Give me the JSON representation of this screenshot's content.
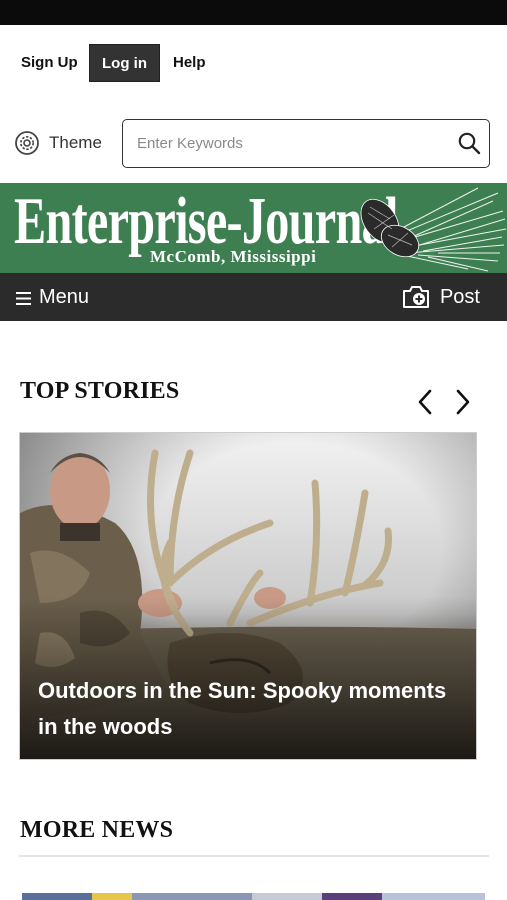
{
  "account": {
    "signup_label": "Sign Up",
    "login_label": "Log in",
    "help_label": "Help"
  },
  "theme": {
    "label": "Theme",
    "icon": "gear-icon"
  },
  "search": {
    "placeholder": "Enter Keywords",
    "value": "",
    "icon": "search-icon"
  },
  "masthead": {
    "title": "Enterprise-Journal",
    "subtitle": "McComb, Mississippi",
    "brand_color": "#3e7f52"
  },
  "nav": {
    "menu_label": "Menu",
    "post_label": "Post",
    "menu_icon": "hamburger-icon",
    "post_icon": "camera-plus-icon",
    "bar_color": "#2b2b2b"
  },
  "top_stories": {
    "title": "TOP STORIES",
    "prev_icon": "chevron-left-icon",
    "next_icon": "chevron-right-icon",
    "stories": [
      {
        "headline": "Outdoors in the Sun: Spooky moments in the woods"
      }
    ]
  },
  "more_news": {
    "title": "MORE NEWS"
  }
}
